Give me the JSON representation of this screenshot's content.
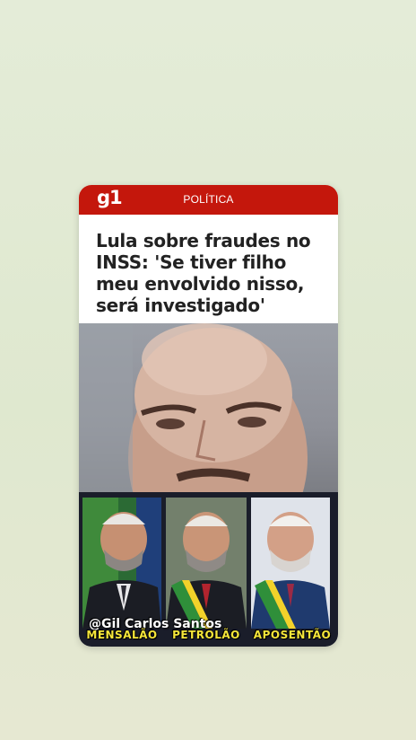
{
  "header": {
    "logo": "g1",
    "section": "POLÍTICA"
  },
  "article": {
    "headline": "Lula sobre fraudes no INSS: 'Se tiver filho meu envolvido nisso, será investigado'"
  },
  "collage": {
    "captions": [
      "MENSALÃO",
      "PETROLÃO",
      "APOSENTÃO"
    ],
    "watermark": "@Gil Carlos Santos"
  },
  "colors": {
    "brand_red": "#c4170c",
    "caption_yellow": "#f5e63a"
  }
}
